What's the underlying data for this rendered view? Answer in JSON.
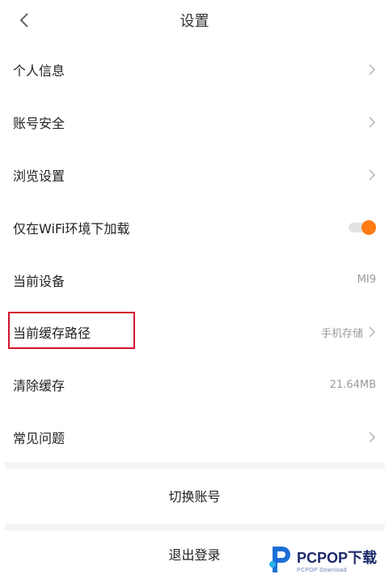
{
  "header": {
    "title": "设置"
  },
  "items": [
    {
      "label": "个人信息",
      "value": "",
      "chevron": true
    },
    {
      "label": "账号安全",
      "value": "",
      "chevron": true
    },
    {
      "label": "浏览设置",
      "value": "",
      "chevron": true
    },
    {
      "label": "仅在WiFi环境下加载",
      "value": "",
      "chevron": false,
      "toggle_on": true
    },
    {
      "label": "当前设备",
      "value": "MI9",
      "chevron": false
    },
    {
      "label": "当前缓存路径",
      "value": "手机存储",
      "chevron": true
    },
    {
      "label": "清除缓存",
      "value": "21.64MB",
      "chevron": false
    },
    {
      "label": "常见问题",
      "value": "",
      "chevron": true
    }
  ],
  "actions": {
    "switch_account": "切换账号",
    "logout": "退出登录"
  },
  "watermark": {
    "main": "PCPOP下载",
    "sub": "PCPOP Download"
  },
  "colors": {
    "accent": "#ff7a12",
    "highlight": "#d3132e",
    "chevron": "#b5b5b5"
  }
}
